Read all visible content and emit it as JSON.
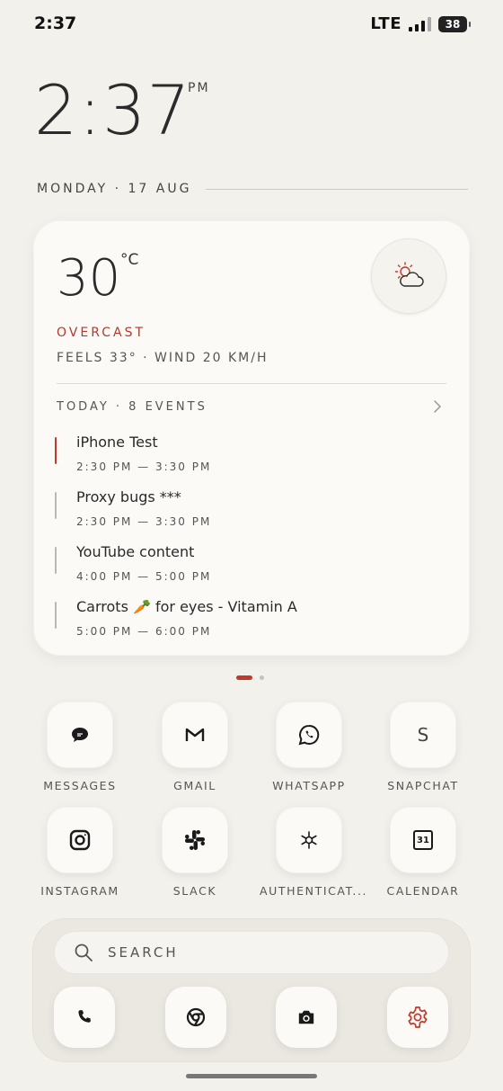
{
  "status_bar": {
    "time": "2:37",
    "network": "LTE",
    "battery": "38"
  },
  "clock": {
    "time": "2:37",
    "ampm": "PM"
  },
  "date": "MONDAY · 17 AUG",
  "weather": {
    "temperature": "30",
    "unit": "°C",
    "condition": "OVERCAST",
    "details": "FEELS 33°  ·  WIND 20 KM/H",
    "icon": "partly-cloudy-icon"
  },
  "calendar": {
    "header": "TODAY · 8 EVENTS",
    "events": [
      {
        "title": "iPhone Test",
        "time": "2:30 PM — 3:30 PM"
      },
      {
        "title": "Proxy bugs ***",
        "time": "2:30 PM — 3:30 PM"
      },
      {
        "title": "YouTube content",
        "time": "4:00 PM — 5:00 PM"
      },
      {
        "title": "Carrots 🥕 for eyes - Vitamin A",
        "time": "5:00 PM — 6:00 PM"
      }
    ]
  },
  "apps": [
    {
      "label": "MESSAGES",
      "icon": "messages-icon"
    },
    {
      "label": "GMAIL",
      "icon": "gmail-icon"
    },
    {
      "label": "WHATSAPP",
      "icon": "whatsapp-icon"
    },
    {
      "label": "SNAPCHAT",
      "icon": "snapchat-icon",
      "glyph": "S"
    },
    {
      "label": "INSTAGRAM",
      "icon": "instagram-icon"
    },
    {
      "label": "SLACK",
      "icon": "slack-icon"
    },
    {
      "label": "AUTHENTICAT...",
      "icon": "authenticator-icon"
    },
    {
      "label": "CALENDAR",
      "icon": "calendar-icon",
      "glyph": "31"
    }
  ],
  "dock": {
    "search_label": "SEARCH",
    "icons": [
      "phone-icon",
      "chrome-icon",
      "camera-icon",
      "settings-icon"
    ]
  },
  "colors": {
    "accent": "#c0392b",
    "background": "#f3f1ec",
    "card": "#fbfaf7"
  }
}
